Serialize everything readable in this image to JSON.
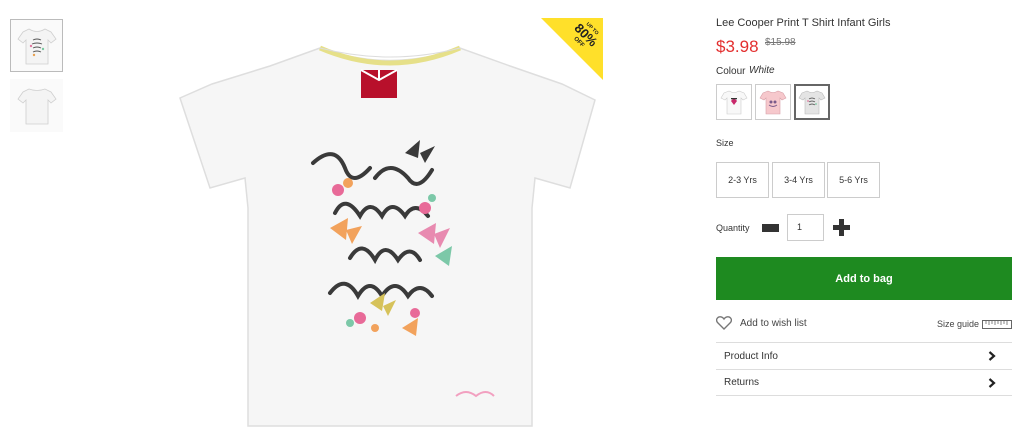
{
  "thumbnails": [
    {
      "name": "front view"
    },
    {
      "name": "back view"
    }
  ],
  "main_image": {
    "alt": "tshirt-front"
  },
  "badge": {
    "line1": "UP TO",
    "line2": "80%",
    "line3": "OFF",
    "color": "#ffe02a"
  },
  "product": {
    "title": "Lee Cooper Print T Shirt Infant Girls",
    "price": "$3.98",
    "old_price": "$15.98",
    "price_color": "#e32f2f"
  },
  "colour": {
    "label": "Colour",
    "value": "White"
  },
  "swatches": [
    "white",
    "pink",
    "grey"
  ],
  "size": {
    "label": "Size",
    "options": [
      "2-3 Yrs",
      "3-4 Yrs",
      "5-6 Yrs"
    ]
  },
  "quantity": {
    "label": "Quantity",
    "value": "1"
  },
  "add_to_bag": {
    "label": "Add to bag",
    "color": "#1e8a20"
  },
  "wishlist": {
    "label": "Add to wish list"
  },
  "size_guide": {
    "label": "Size guide"
  },
  "accordion": [
    {
      "label": "Product Info"
    },
    {
      "label": "Returns"
    }
  ]
}
